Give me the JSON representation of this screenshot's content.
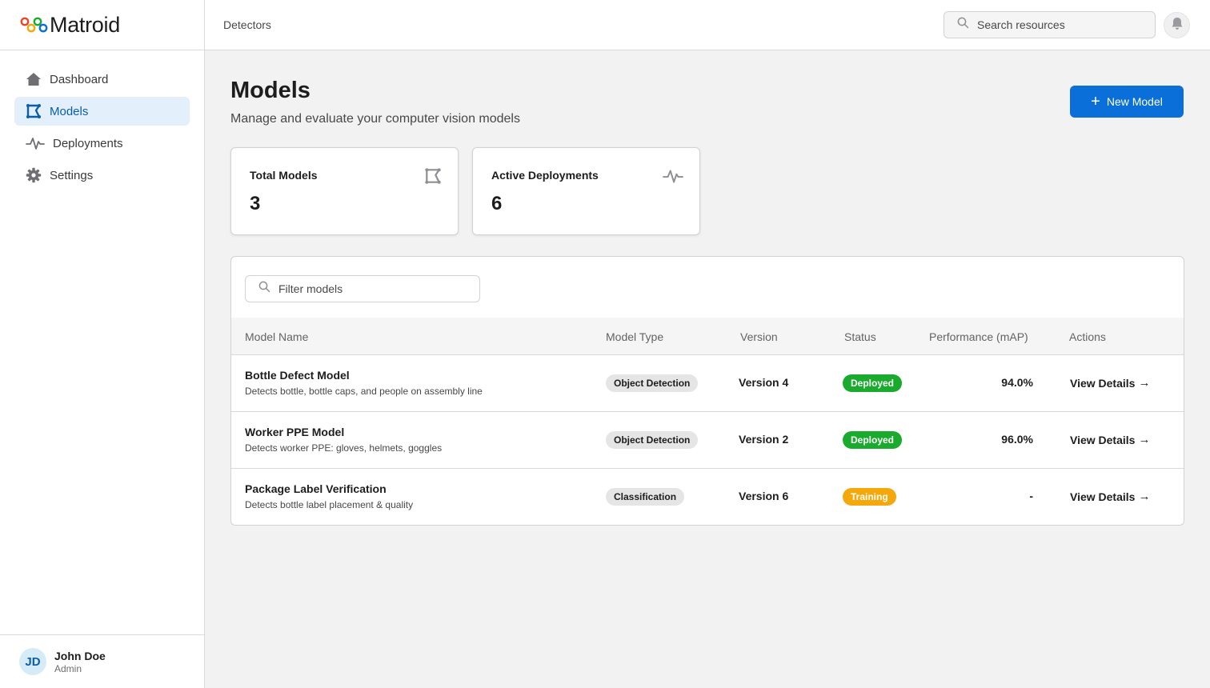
{
  "brand": {
    "name": "Matroid"
  },
  "sidebar": {
    "items": [
      {
        "label": "Dashboard",
        "icon": "home-icon",
        "active": false
      },
      {
        "label": "Models",
        "icon": "model-icon",
        "active": true
      },
      {
        "label": "Deployments",
        "icon": "activity-icon",
        "active": false
      },
      {
        "label": "Settings",
        "icon": "gear-icon",
        "active": false
      }
    ]
  },
  "user": {
    "initials": "JD",
    "name": "John Doe",
    "role": "Admin"
  },
  "topbar": {
    "breadcrumb": "Detectors",
    "search_placeholder": "Search resources"
  },
  "page": {
    "title": "Models",
    "subtitle": "Manage and evaluate your computer vision models",
    "new_button": "New Model"
  },
  "stats": [
    {
      "label": "Total Models",
      "value": "3",
      "icon": "model-icon"
    },
    {
      "label": "Active Deployments",
      "value": "6",
      "icon": "activity-icon"
    }
  ],
  "table": {
    "filter_placeholder": "Filter models",
    "columns": [
      "Model Name",
      "Model Type",
      "Version",
      "Status",
      "Performance (mAP)",
      "Actions"
    ],
    "rows": [
      {
        "name": "Bottle Defect Model",
        "description": "Detects bottle, bottle caps, and people on assembly line",
        "type": "Object Detection",
        "version": "Version 4",
        "status": "Deployed",
        "performance": "94.0%",
        "action": "View Details"
      },
      {
        "name": "Worker PPE Model",
        "description": "Detects worker PPE: gloves, helmets, goggles",
        "type": "Object Detection",
        "version": "Version 2",
        "status": "Deployed",
        "performance": "96.0%",
        "action": "View Details"
      },
      {
        "name": "Package Label Verification",
        "description": "Detects bottle label placement & quality",
        "type": "Classification",
        "version": "Version 6",
        "status": "Training",
        "performance": "-",
        "action": "View Details"
      }
    ]
  },
  "colors": {
    "accent": "#0a6fd8",
    "deployed": "#1aab2e",
    "training": "#f5a80c",
    "active_nav_bg": "#e3effa"
  }
}
